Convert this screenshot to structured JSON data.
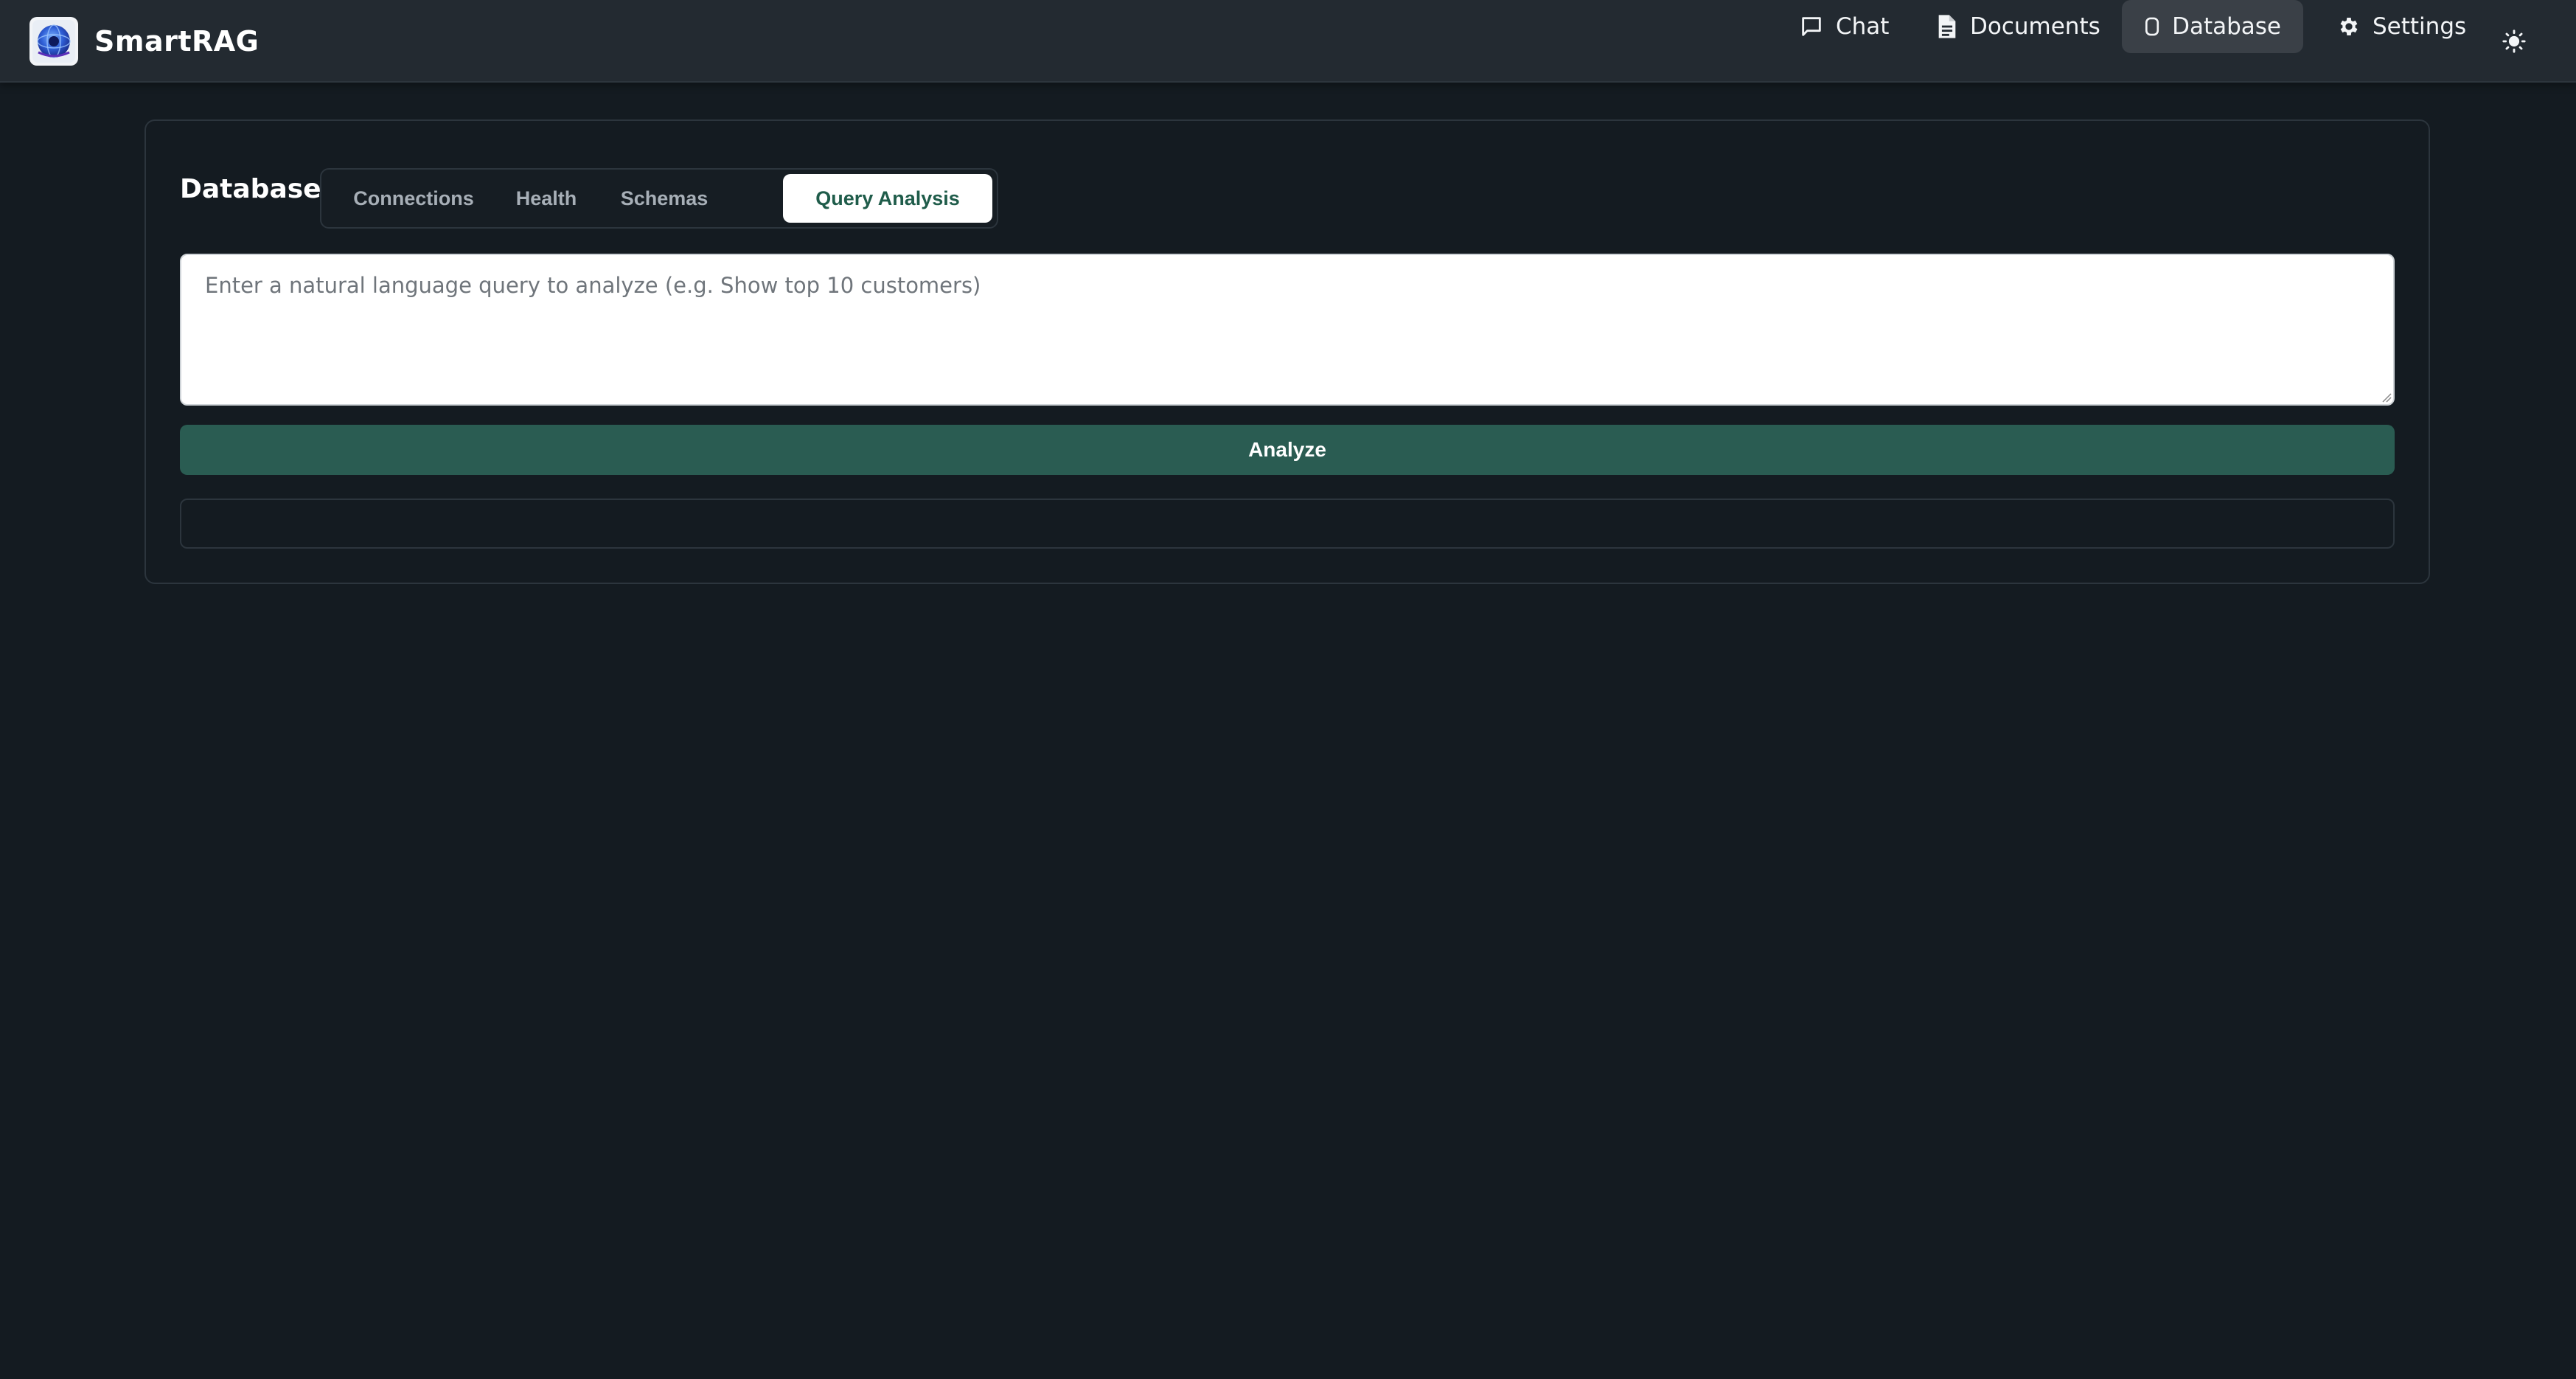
{
  "app": {
    "name": "SmartRAG",
    "logo_icon": "globe-logo-icon"
  },
  "nav": {
    "items": [
      {
        "label": "Chat",
        "icon": "chat-bubble-icon",
        "active": false
      },
      {
        "label": "Documents",
        "icon": "document-icon",
        "active": false
      },
      {
        "label": "Database",
        "icon": "database-icon",
        "active": true
      },
      {
        "label": "Settings",
        "icon": "gear-icon",
        "active": false
      }
    ],
    "theme_toggle_icon": "sun-icon"
  },
  "database": {
    "title": "Database",
    "tabs": [
      {
        "label": "Connections",
        "active": false
      },
      {
        "label": "Health",
        "active": false
      },
      {
        "label": "Schemas",
        "active": false
      },
      {
        "label": "Query Analysis",
        "active": true
      }
    ],
    "query": {
      "value": "",
      "placeholder": "Enter a natural language query to analyze (e.g. Show top 10 customers)"
    },
    "analyze_label": "Analyze",
    "result": ""
  },
  "colors": {
    "background": "#141b21",
    "navbar": "#232a31",
    "accent": "#2a5c52",
    "active_tab_text": "#1f5c4a"
  }
}
